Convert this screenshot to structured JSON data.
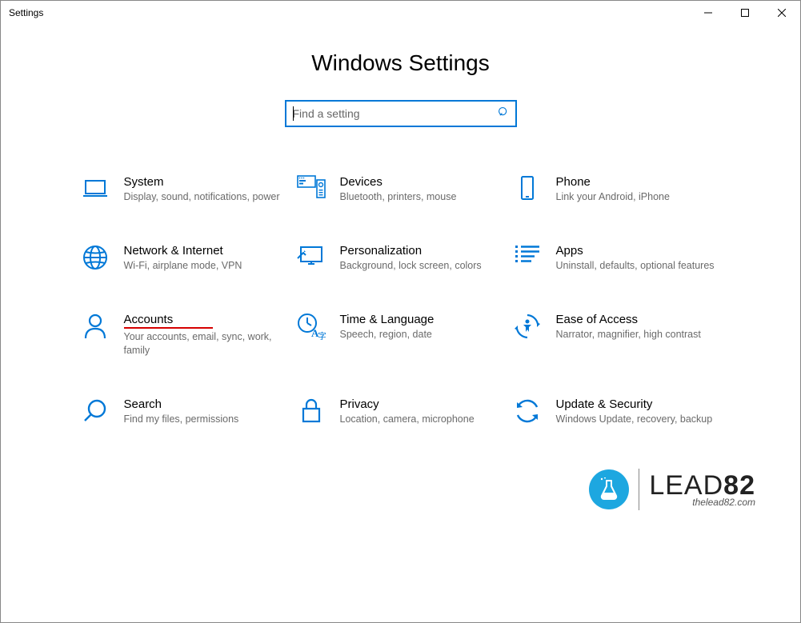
{
  "window": {
    "title": "Settings"
  },
  "page": {
    "heading": "Windows Settings"
  },
  "search": {
    "placeholder": "Find a setting"
  },
  "tiles": [
    {
      "id": "system",
      "icon": "laptop-icon",
      "title": "System",
      "desc": "Display, sound, notifications, power"
    },
    {
      "id": "devices",
      "icon": "devices-icon",
      "title": "Devices",
      "desc": "Bluetooth, printers, mouse"
    },
    {
      "id": "phone",
      "icon": "phone-icon",
      "title": "Phone",
      "desc": "Link your Android, iPhone"
    },
    {
      "id": "network",
      "icon": "globe-icon",
      "title": "Network & Internet",
      "desc": "Wi-Fi, airplane mode, VPN"
    },
    {
      "id": "personalization",
      "icon": "personalization-icon",
      "title": "Personalization",
      "desc": "Background, lock screen, colors"
    },
    {
      "id": "apps",
      "icon": "apps-icon",
      "title": "Apps",
      "desc": "Uninstall, defaults, optional features"
    },
    {
      "id": "accounts",
      "icon": "person-icon",
      "title": "Accounts",
      "desc": "Your accounts, email, sync, work, family",
      "highlight": true
    },
    {
      "id": "time-language",
      "icon": "time-language-icon",
      "title": "Time & Language",
      "desc": "Speech, region, date"
    },
    {
      "id": "ease-of-access",
      "icon": "accessibility-icon",
      "title": "Ease of Access",
      "desc": "Narrator, magnifier, high contrast"
    },
    {
      "id": "search",
      "icon": "search-icon",
      "title": "Search",
      "desc": "Find my files, permissions"
    },
    {
      "id": "privacy",
      "icon": "lock-icon",
      "title": "Privacy",
      "desc": "Location, camera, microphone"
    },
    {
      "id": "update-security",
      "icon": "update-icon",
      "title": "Update & Security",
      "desc": "Windows Update, recovery, backup"
    }
  ],
  "watermark": {
    "brand_a": "LEAD",
    "brand_b": "82",
    "url": "thelead82.com"
  }
}
